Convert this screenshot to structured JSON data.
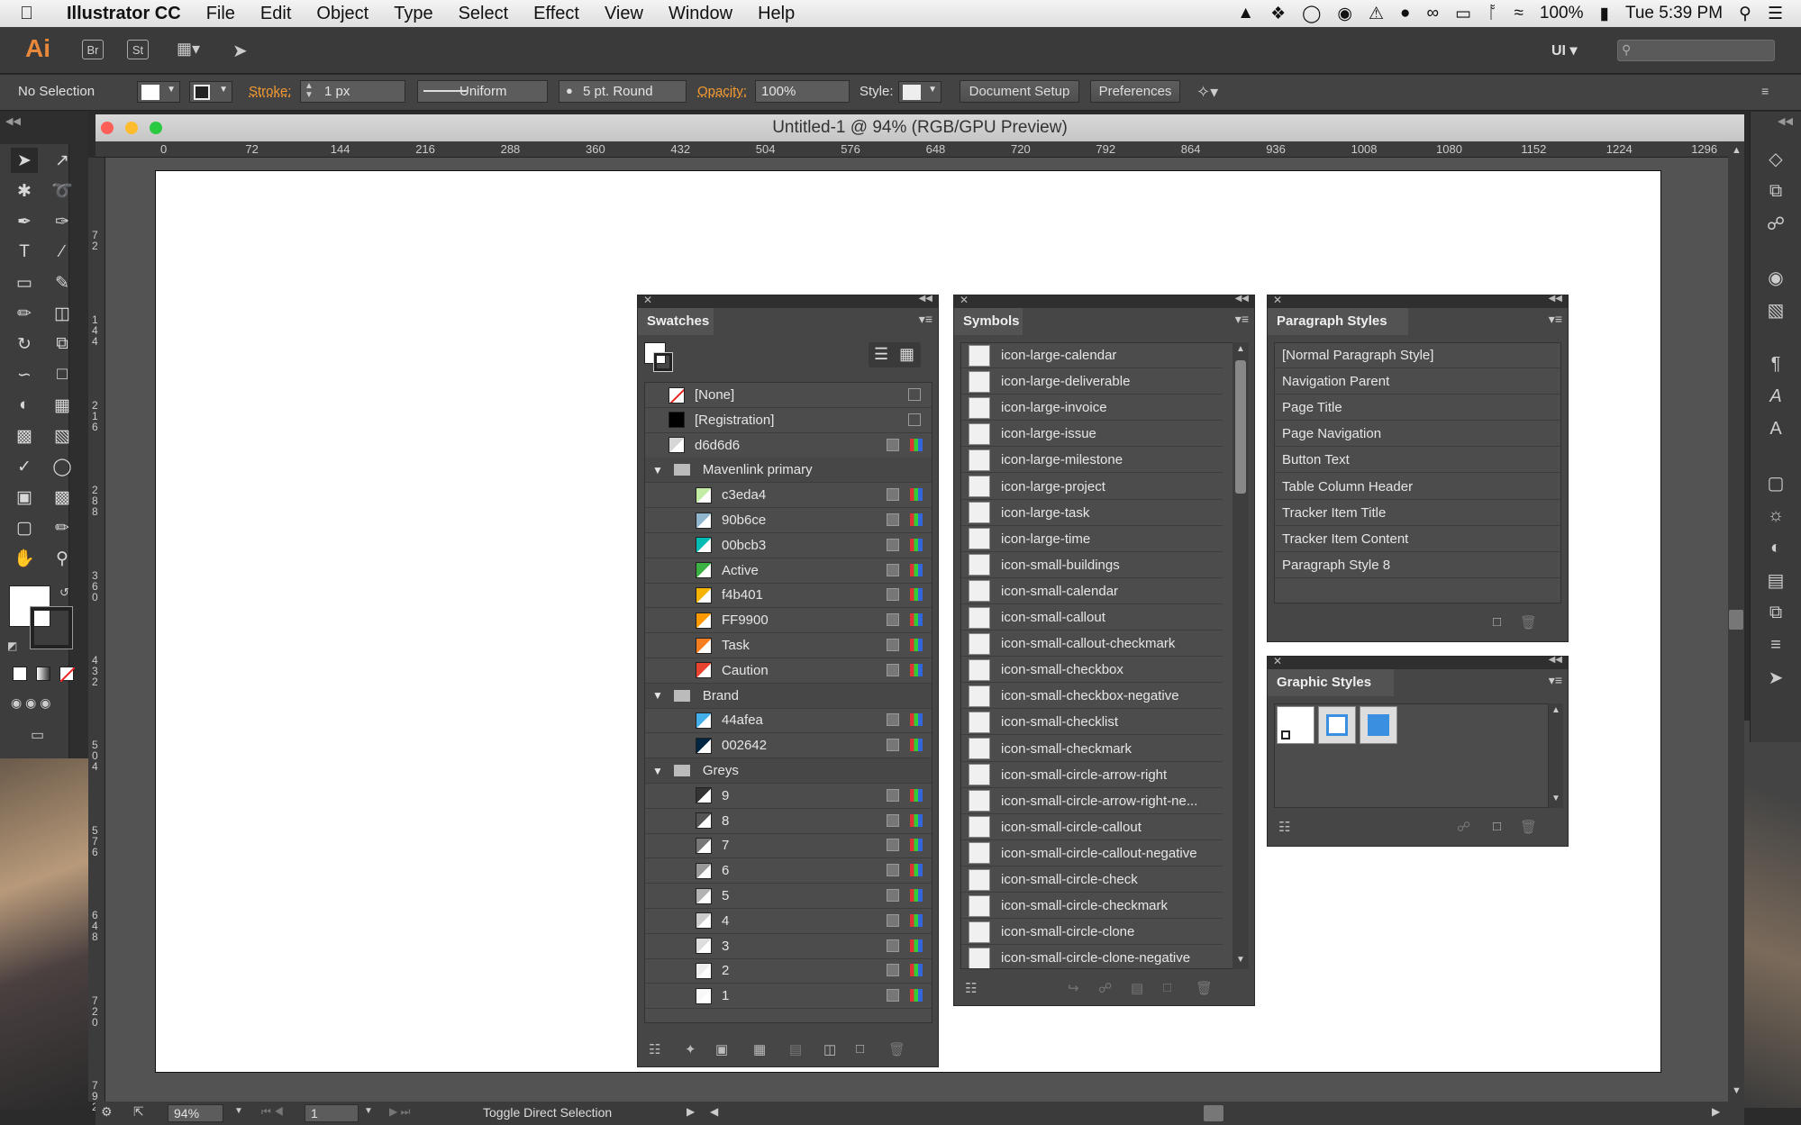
{
  "menubar": {
    "app_name": "Illustrator CC",
    "items": [
      "File",
      "Edit",
      "Object",
      "Type",
      "Select",
      "Effect",
      "View",
      "Window",
      "Help"
    ],
    "battery": "100%",
    "clock": "Tue 5:39 PM"
  },
  "approw": {
    "logo": "Ai",
    "bridge": "Br",
    "stock": "St",
    "workspace": "UI"
  },
  "control": {
    "selection": "No Selection",
    "stroke_label": "Stroke:",
    "stroke_value": "1 px",
    "profile": "Uniform",
    "brush": "5 pt. Round",
    "opacity_label": "Opacity:",
    "opacity_value": "100%",
    "style_label": "Style:",
    "doc_setup": "Document Setup",
    "preferences": "Preferences"
  },
  "document": {
    "title": "Untitled-1 @ 94% (RGB/GPU Preview)",
    "ruler_h": [
      "0",
      "72",
      "144",
      "216",
      "288",
      "360",
      "432",
      "504",
      "576",
      "648",
      "720",
      "792",
      "864",
      "936",
      "1008",
      "1080",
      "1152",
      "1224",
      "1296"
    ],
    "ruler_v": [
      "7\n2",
      "1\n4\n4",
      "2\n1\n6",
      "2\n8\n8",
      "3\n6\n0",
      "4\n3\n2",
      "5\n0\n4",
      "5\n7\n6",
      "6\n4\n8",
      "7\n2\n0",
      "7\n9\n2"
    ]
  },
  "status": {
    "zoom": "94%",
    "page": "1",
    "message": "Toggle Direct Selection"
  },
  "swatches": {
    "title": "Swatches",
    "rows": [
      {
        "label": "[None]",
        "color": "none",
        "kind": "none",
        "indent": false
      },
      {
        "label": "[Registration]",
        "color": "#000000",
        "kind": "reg",
        "indent": false
      },
      {
        "label": "d6d6d6",
        "color": "#d6d6d6",
        "kind": "swatch",
        "indent": false
      },
      {
        "label": "Mavenlink primary",
        "kind": "group"
      },
      {
        "label": "c3eda4",
        "color": "#c3eda4",
        "kind": "swatch",
        "indent": true
      },
      {
        "label": "90b6ce",
        "color": "#90b6ce",
        "kind": "swatch",
        "indent": true
      },
      {
        "label": "00bcb3",
        "color": "#00bcb3",
        "kind": "swatch",
        "indent": true
      },
      {
        "label": "Active",
        "color": "#3cb043",
        "kind": "swatch",
        "indent": true
      },
      {
        "label": "f4b401",
        "color": "#f4b401",
        "kind": "swatch",
        "indent": true
      },
      {
        "label": "FF9900",
        "color": "#ff9900",
        "kind": "swatch",
        "indent": true
      },
      {
        "label": "Task",
        "color": "#f47d20",
        "kind": "swatch",
        "indent": true
      },
      {
        "label": "Caution",
        "color": "#e8442f",
        "kind": "swatch",
        "indent": true
      },
      {
        "label": "Brand",
        "kind": "group"
      },
      {
        "label": "44afea",
        "color": "#44afea",
        "kind": "swatch",
        "indent": true
      },
      {
        "label": "002642",
        "color": "#002642",
        "kind": "swatch",
        "indent": true
      },
      {
        "label": "Greys",
        "kind": "group"
      },
      {
        "label": "9",
        "color": "#333333",
        "kind": "swatch",
        "indent": true
      },
      {
        "label": "8",
        "color": "#555555",
        "kind": "swatch",
        "indent": true
      },
      {
        "label": "7",
        "color": "#777777",
        "kind": "swatch",
        "indent": true
      },
      {
        "label": "6",
        "color": "#999999",
        "kind": "swatch",
        "indent": true
      },
      {
        "label": "5",
        "color": "#b3b3b3",
        "kind": "swatch",
        "indent": true
      },
      {
        "label": "4",
        "color": "#cccccc",
        "kind": "swatch",
        "indent": true
      },
      {
        "label": "3",
        "color": "#dddddd",
        "kind": "swatch",
        "indent": true
      },
      {
        "label": "2",
        "color": "#eeeeee",
        "kind": "swatch",
        "indent": true
      },
      {
        "label": "1",
        "color": "#f8f8f8",
        "kind": "swatch",
        "indent": true
      }
    ]
  },
  "symbols": {
    "title": "Symbols",
    "items": [
      "icon-large-calendar",
      "icon-large-deliverable",
      "icon-large-invoice",
      "icon-large-issue",
      "icon-large-milestone",
      "icon-large-project",
      "icon-large-task",
      "icon-large-time",
      "icon-small-buildings",
      "icon-small-calendar",
      "icon-small-callout",
      "icon-small-callout-checkmark",
      "icon-small-checkbox",
      "icon-small-checkbox-negative",
      "icon-small-checklist",
      "icon-small-checkmark",
      "icon-small-circle-arrow-right",
      "icon-small-circle-arrow-right-ne...",
      "icon-small-circle-callout",
      "icon-small-circle-callout-negative",
      "icon-small-circle-check",
      "icon-small-circle-checkmark",
      "icon-small-circle-clone",
      "icon-small-circle-clone-negative"
    ]
  },
  "paragraph_styles": {
    "title": "Paragraph Styles",
    "items": [
      "[Normal Paragraph Style]",
      "Navigation Parent",
      "Page Title",
      "Page Navigation",
      "Button Text",
      "Table Column Header",
      "Tracker Item Title",
      "Tracker Item Content",
      "Paragraph Style 8"
    ]
  },
  "graphic_styles": {
    "title": "Graphic Styles"
  }
}
